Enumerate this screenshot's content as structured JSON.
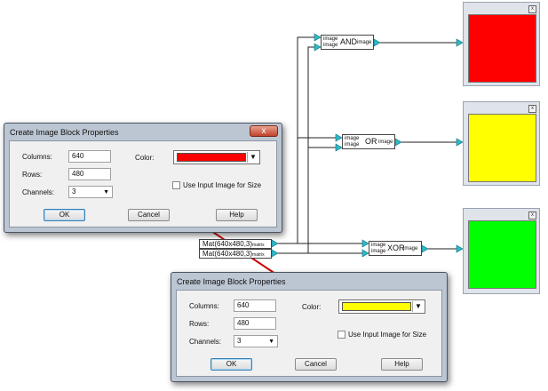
{
  "blocks": {
    "and": {
      "in1": "image",
      "in2": "image",
      "op": "AND",
      "out": "image"
    },
    "or": {
      "in1": "image",
      "in2": "image",
      "op": "OR",
      "out": "image"
    },
    "xor": {
      "in1": "image",
      "in2": "image",
      "op": "XOR",
      "out": "image"
    }
  },
  "sources": [
    {
      "label": "Mat(640x480,3)",
      "port": "matrix"
    },
    {
      "label": "Mat(640x480,3)",
      "port": "matrix"
    }
  ],
  "viewers": [
    {
      "close": "x",
      "color": "#ff0000"
    },
    {
      "close": "x",
      "color": "#ffff00"
    },
    {
      "close": "x",
      "color": "#00ff00"
    }
  ],
  "dialogs": [
    {
      "title": "Create Image Block Properties",
      "close": "x",
      "columns_label": "Columns:",
      "columns": "640",
      "rows_label": "Rows:",
      "rows": "480",
      "channels_label": "Channels:",
      "channels": "3",
      "color_label": "Color:",
      "color": "#ff0000",
      "use_input_label": "Use Input Image for Size",
      "ok": "OK",
      "cancel": "Cancel",
      "help": "Help"
    },
    {
      "title": "Create Image Block Properties",
      "close": "x",
      "columns_label": "Columns:",
      "columns": "640",
      "rows_label": "Rows:",
      "rows": "480",
      "channels_label": "Channels:",
      "channels": "3",
      "color_label": "Color:",
      "color": "#ffff00",
      "use_input_label": "Use Input Image for Size",
      "ok": "OK",
      "cancel": "Cancel",
      "help": "Help"
    }
  ],
  "accent": {
    "port": "#2fb8c8",
    "highlight": "#cc0000"
  }
}
